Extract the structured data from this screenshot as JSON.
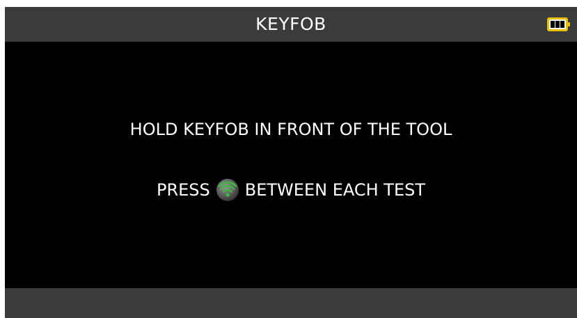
{
  "header": {
    "title": "KEYFOB",
    "battery_icon": "battery-full-icon",
    "battery_color": "#e8c000"
  },
  "instructions": {
    "line1": "HOLD KEYFOB IN FRONT OF THE TOOL",
    "line2_before": "PRESS",
    "line2_icon": "test-button-icon",
    "line2_after": "BETWEEN EACH TEST"
  },
  "colors": {
    "background": "#000000",
    "bar": "#3b3b3b",
    "text": "#ffffff",
    "icon_green": "#3fb83f"
  }
}
